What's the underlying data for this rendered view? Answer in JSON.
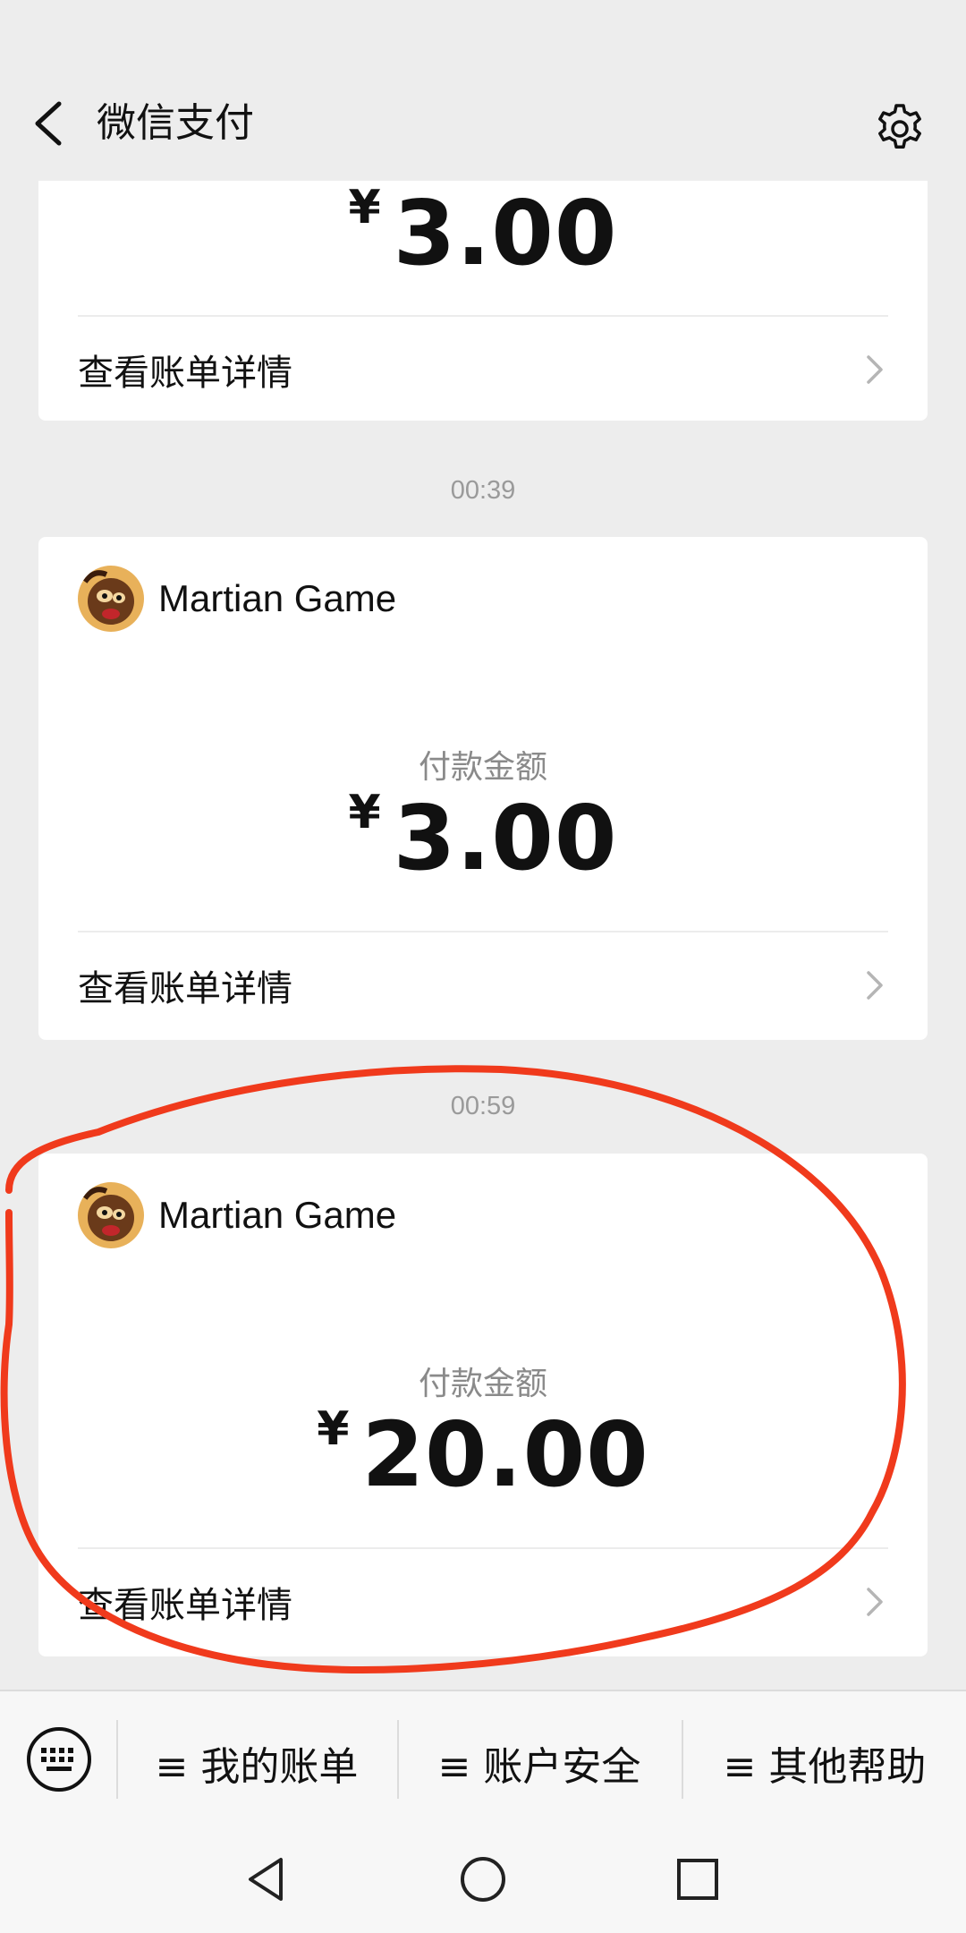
{
  "header": {
    "title": "微信支付"
  },
  "cards": [
    {
      "amount_currency": "¥",
      "amount_value": "3.00",
      "detail_label": "查看账单详情"
    },
    {
      "time": "00:39",
      "merchant": "Martian Game",
      "amount_label": "付款金额",
      "amount_currency": "¥",
      "amount_value": "3.00",
      "detail_label": "查看账单详情"
    },
    {
      "time": "00:59",
      "merchant": "Martian Game",
      "amount_label": "付款金额",
      "amount_currency": "¥",
      "amount_value": "20.00",
      "detail_label": "查看账单详情"
    }
  ],
  "bottom_menu": {
    "items": [
      "≡ 我的账单",
      "≡ 账户安全",
      "≡ 其他帮助"
    ]
  },
  "icons": {
    "back": "back-arrow-icon",
    "settings": "gear-icon",
    "keyboard": "keyboard-icon",
    "nav_back": "triangle-back-icon",
    "nav_home": "circle-home-icon",
    "nav_recent": "square-recent-icon"
  },
  "colors": {
    "background": "#ededed",
    "card": "#ffffff",
    "annotation": "#f03a1c"
  }
}
